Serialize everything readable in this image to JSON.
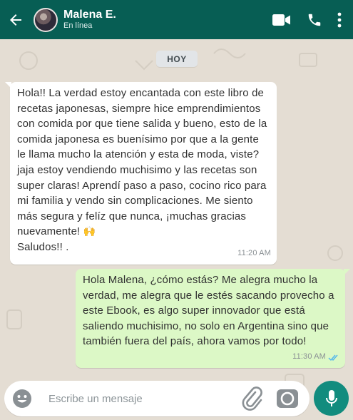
{
  "header": {
    "contact_name": "Malena E.",
    "contact_status": "En línea",
    "icons": [
      "back-arrow-icon",
      "avatar",
      "video-call-icon",
      "phone-icon",
      "kebab-menu-icon"
    ]
  },
  "date_chip": "HOY",
  "messages": [
    {
      "direction": "incoming",
      "text": "Hola!! La verdad estoy encantada con este libro de recetas japonesas, siempre hice emprendimientos con comida por que tiene salida y bueno, esto de la comida japonesa es buenísimo por que a la gente le llama mucho la atención y esta de moda, viste? jaja estoy vendiendo muchisimo y las recetas son super claras! Aprendí paso a paso, cocino rico para mi familia y vendo sin complicaciones. Me siento más segura y felíz que nunca, ¡muchas gracias nuevamente!",
      "emoji": "🙌",
      "text_end": "Saludos!! .",
      "time": "11:20 AM"
    },
    {
      "direction": "outgoing",
      "text": "Hola Malena, ¿cómo estás? Me alegra mucho la verdad, me alegra que le estés sacando provecho a este Ebook, es algo super innovador que está saliendo muchisimo, no solo en Argentina sino que también fuera del país, ahora vamos por todo!",
      "time": "11:30 AM",
      "status_icon": "double-check-read-icon"
    }
  ],
  "composer": {
    "placeholder": "Escribe un mensaje",
    "value": ""
  },
  "colors": {
    "header_bg": "#075e54",
    "chat_bg": "#e4ddd3",
    "outgoing_bubble": "#dcf8c6",
    "incoming_bubble": "#ffffff",
    "mic_button": "#128c7e",
    "read_check": "#4fb6ec"
  }
}
